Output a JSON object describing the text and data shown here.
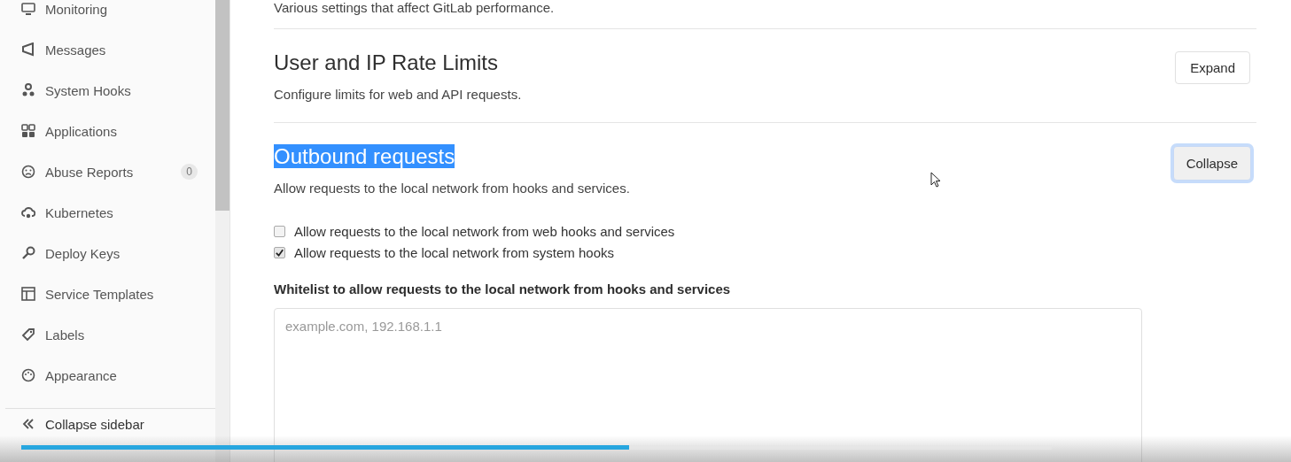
{
  "sidebar": {
    "items": [
      {
        "label": "Monitoring"
      },
      {
        "label": "Messages"
      },
      {
        "label": "System Hooks"
      },
      {
        "label": "Applications"
      },
      {
        "label": "Abuse Reports",
        "badge": "0"
      },
      {
        "label": "Kubernetes"
      },
      {
        "label": "Deploy Keys"
      },
      {
        "label": "Service Templates"
      },
      {
        "label": "Labels"
      },
      {
        "label": "Appearance"
      },
      {
        "label": "Collapse sidebar"
      }
    ]
  },
  "previous_section": {
    "description": "Various settings that affect GitLab performance."
  },
  "sections": [
    {
      "title": "User and IP Rate Limits",
      "title_highlighted": false,
      "description": "Configure limits for web and API requests.",
      "button": "Expand",
      "button_focused": false
    },
    {
      "title": "Outbound requests",
      "title_highlighted": true,
      "description": "Allow requests to the local network from hooks and services.",
      "button": "Collapse",
      "button_focused": true,
      "checkboxes": [
        {
          "label": "Allow requests to the local network from web hooks and services",
          "checked": false
        },
        {
          "label": "Allow requests to the local network from system hooks",
          "checked": true
        }
      ],
      "field": {
        "label": "Whitelist to allow requests to the local network from hooks and services",
        "placeholder": "example.com, 192.168.1.1"
      }
    }
  ],
  "video_player": {
    "progress": {
      "level": 0.59
    }
  }
}
